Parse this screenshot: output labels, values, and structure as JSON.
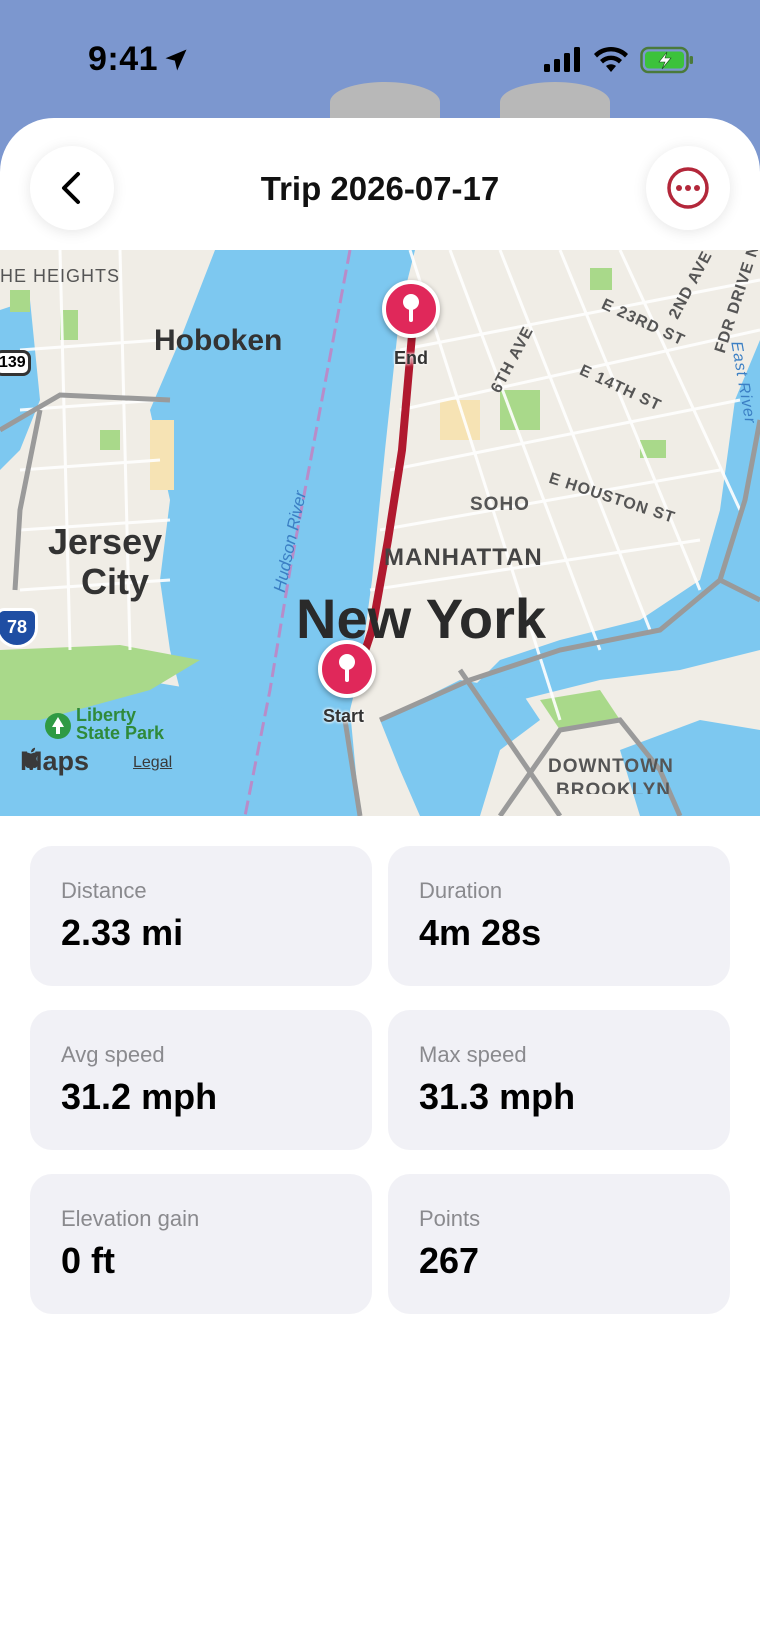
{
  "status_bar": {
    "time": "9:41",
    "icons": [
      "location-arrow-icon",
      "cellular-signal-icon",
      "wifi-icon",
      "battery-charging-icon"
    ]
  },
  "header": {
    "title": "Trip 2026-07-17",
    "back_icon": "chevron-left-icon",
    "more_icon": "ellipsis-circle-icon",
    "accent_color": "#b3273a"
  },
  "map": {
    "labels": {
      "heights": "HE HEIGHTS",
      "hoboken": "Hoboken",
      "jersey_city_line1": "Jersey",
      "jersey_city_line2": "City",
      "new_york": "New York",
      "manhattan": "MANHATTAN",
      "soho": "SOHO",
      "hudson_river": "Hudson River",
      "sixth_ave": "6TH AVE",
      "e23": "E 23RD ST",
      "e14": "E 14TH ST",
      "second_ave": "2ND AVE",
      "fdr": "FDR DRIVE N",
      "east_river": "East River",
      "houston": "E HOUSTON ST",
      "liberty_line1": "Liberty",
      "liberty_line2": "State Park",
      "downtown_line1": "DOWNTOWN",
      "downtown_line2": "BROOKLYN",
      "route_139": "139",
      "route_78": "78"
    },
    "pins": {
      "end_label": "End",
      "start_label": "Start",
      "color": "#e0285a"
    },
    "route_color": "#b0192f",
    "brand": "Maps",
    "legal": "Legal",
    "colors": {
      "water": "#7dc8f0",
      "land": "#f0ede6",
      "park": "#a9d98a"
    }
  },
  "stats": [
    {
      "label": "Distance",
      "value": "2.33 mi"
    },
    {
      "label": "Duration",
      "value": "4m 28s"
    },
    {
      "label": "Avg speed",
      "value": "31.2 mph"
    },
    {
      "label": "Max speed",
      "value": "31.3 mph"
    },
    {
      "label": "Elevation gain",
      "value": "0 ft"
    },
    {
      "label": "Points",
      "value": "267"
    }
  ]
}
